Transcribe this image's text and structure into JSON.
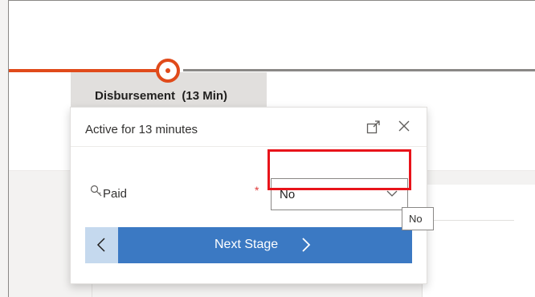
{
  "stage": {
    "name": "Disbursement",
    "duration_label": "(13 Min)"
  },
  "flyout": {
    "title": "Active for 13 minutes",
    "field": {
      "label": "Paid",
      "required_marker": "*",
      "value": "No"
    },
    "next_label": "Next Stage",
    "tooltip": "No"
  },
  "colors": {
    "active_stage": "#e04a1a",
    "nav_button": "#3b79c3",
    "back_button": "#c5d9ee",
    "highlight": "#e8131a"
  },
  "icons": [
    "expand-icon",
    "close-icon",
    "key-icon",
    "chevron-down-icon",
    "chevron-left-icon",
    "chevron-right-icon"
  ]
}
